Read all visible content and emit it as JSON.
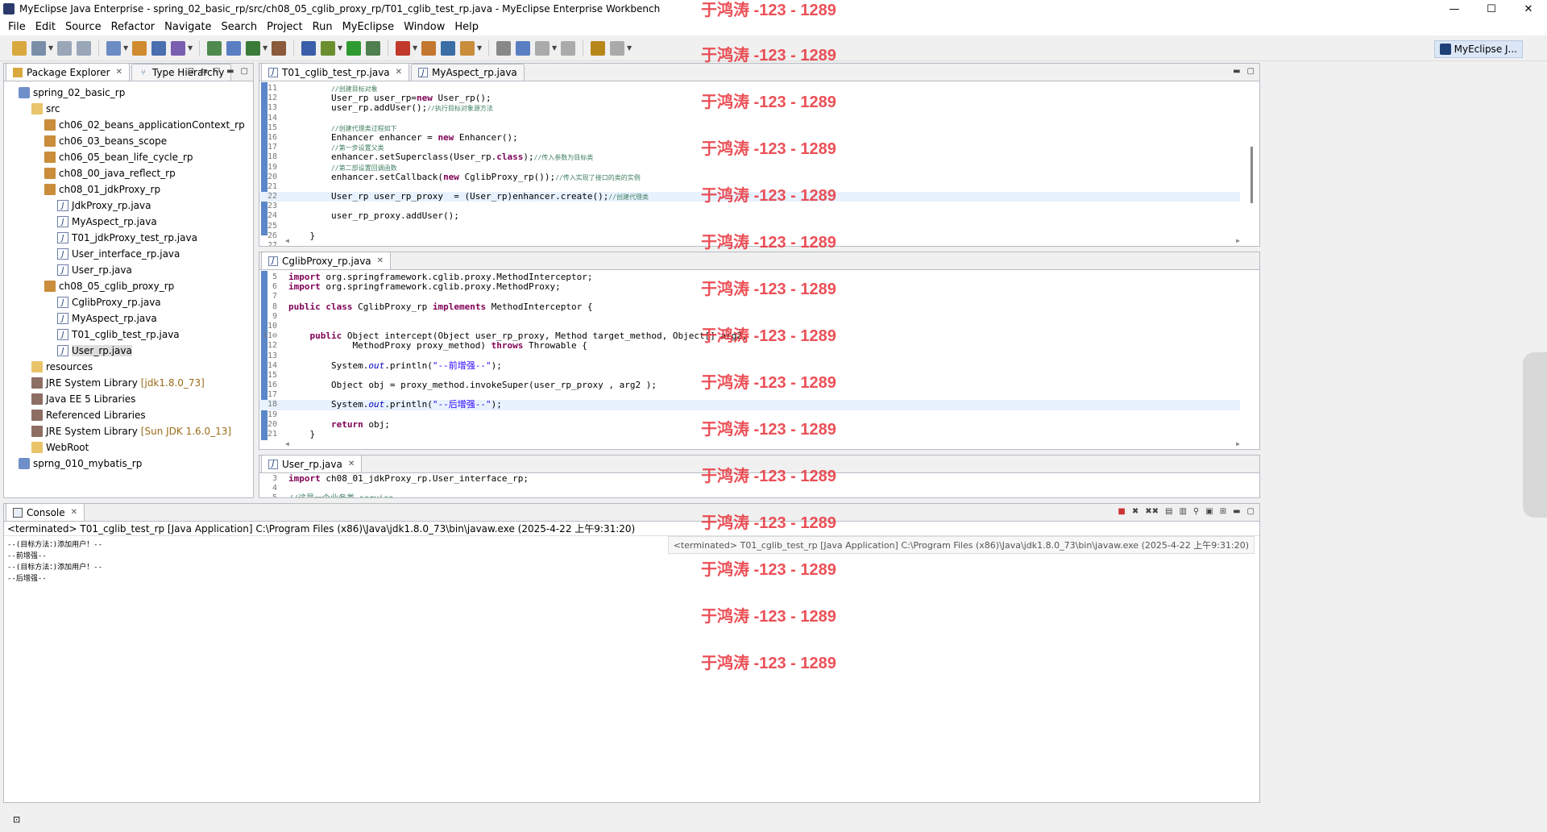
{
  "window": {
    "title": "MyEclipse Java Enterprise - spring_02_basic_rp/src/ch08_05_cglib_proxy_rp/T01_cglib_test_rp.java - MyEclipse Enterprise Workbench",
    "minimize": "—",
    "maximize": "☐",
    "close": "✕"
  },
  "menu": [
    "File",
    "Edit",
    "Source",
    "Refactor",
    "Navigate",
    "Search",
    "Project",
    "Run",
    "MyEclipse",
    "Window",
    "Help"
  ],
  "perspective": {
    "label": "MyEclipse J..."
  },
  "explorer": {
    "tabs": [
      "Package Explorer",
      "Type Hierarchy"
    ],
    "tree": [
      {
        "label": "spring_02_basic_rp",
        "indent": 0,
        "icon": "project-icon"
      },
      {
        "label": "src",
        "indent": 1,
        "icon": "source-folder-icon"
      },
      {
        "label": "ch06_02_beans_applicationContext_rp",
        "indent": 2,
        "icon": "package-icon"
      },
      {
        "label": "ch06_03_beans_scope",
        "indent": 2,
        "icon": "package-icon"
      },
      {
        "label": "ch06_05_bean_life_cycle_rp",
        "indent": 2,
        "icon": "package-icon"
      },
      {
        "label": "ch08_00_java_reflect_rp",
        "indent": 2,
        "icon": "package-icon"
      },
      {
        "label": "ch08_01_jdkProxy_rp",
        "indent": 2,
        "icon": "package-icon"
      },
      {
        "label": "JdkProxy_rp.java",
        "indent": 3,
        "icon": "java-file-icon"
      },
      {
        "label": "MyAspect_rp.java",
        "indent": 3,
        "icon": "java-file-icon"
      },
      {
        "label": "T01_jdkProxy_test_rp.java",
        "indent": 3,
        "icon": "java-file-icon"
      },
      {
        "label": "User_interface_rp.java",
        "indent": 3,
        "icon": "java-file-icon"
      },
      {
        "label": "User_rp.java",
        "indent": 3,
        "icon": "java-file-icon"
      },
      {
        "label": "ch08_05_cglib_proxy_rp",
        "indent": 2,
        "icon": "package-icon"
      },
      {
        "label": "CglibProxy_rp.java",
        "indent": 3,
        "icon": "java-file-icon"
      },
      {
        "label": "MyAspect_rp.java",
        "indent": 3,
        "icon": "java-file-icon"
      },
      {
        "label": "T01_cglib_test_rp.java",
        "indent": 3,
        "icon": "java-file-icon"
      },
      {
        "label": "User_rp.java",
        "indent": 3,
        "icon": "java-file-icon",
        "selected": true
      },
      {
        "label": "resources",
        "indent": 1,
        "icon": "source-folder-icon"
      },
      {
        "label": "JRE System Library",
        "indent": 1,
        "icon": "library-icon",
        "extra": "[jdk1.8.0_73]"
      },
      {
        "label": "Java EE 5 Libraries",
        "indent": 1,
        "icon": "library-icon"
      },
      {
        "label": "Referenced Libraries",
        "indent": 1,
        "icon": "library-icon"
      },
      {
        "label": "JRE System Library",
        "indent": 1,
        "icon": "library-icon",
        "extra": "[Sun JDK 1.6.0_13]"
      },
      {
        "label": "WebRoot",
        "indent": 1,
        "icon": "folder-icon"
      },
      {
        "label": "sprng_010_mybatis_rp",
        "indent": 0,
        "icon": "project-icon"
      }
    ]
  },
  "editor1": {
    "tabs": [
      "T01_cglib_test_rp.java",
      "MyAspect_rp.java"
    ],
    "lines": [
      {
        "n": "11",
        "html": "        <span class=\"cm\">//创建目标对象</span>"
      },
      {
        "n": "12",
        "html": "        User_rp user_rp=<span class=\"kw\">new</span> User_rp();"
      },
      {
        "n": "13",
        "html": "        user_rp.addUser();<span class=\"cm\">//执行目标对象源方法</span>"
      },
      {
        "n": "14",
        "html": ""
      },
      {
        "n": "15",
        "html": "        <span class=\"cm\">//创建代理类过程如下</span>"
      },
      {
        "n": "16",
        "html": "        Enhancer enhancer = <span class=\"kw\">new</span> Enhancer();"
      },
      {
        "n": "17",
        "html": "        <span class=\"cm\">//第一步设置父类</span>"
      },
      {
        "n": "18",
        "html": "        enhancer.setSuperclass(User_rp.<span class=\"kw\">class</span>);<span class=\"cm\">//传入参数为目标类</span>"
      },
      {
        "n": "19",
        "html": "        <span class=\"cm\">//第二部设置回调函数</span>"
      },
      {
        "n": "20",
        "html": "        enhancer.setCallback(<span class=\"kw\">new</span> CglibProxy_rp());<span class=\"cm\">//传入实现了接口的类的实例</span>"
      },
      {
        "n": "21",
        "html": ""
      },
      {
        "n": "22",
        "html": "        User_rp user_rp_proxy  = (User_rp)enhancer.create();<span class=\"cm\">//创建代理类</span>",
        "hl": true
      },
      {
        "n": "23",
        "html": ""
      },
      {
        "n": "24",
        "html": "        user_rp_proxy.addUser();"
      },
      {
        "n": "25",
        "html": ""
      },
      {
        "n": "26",
        "html": "    }"
      },
      {
        "n": "27",
        "html": ""
      }
    ]
  },
  "editor2": {
    "tabs": [
      "CglibProxy_rp.java"
    ],
    "lines": [
      {
        "n": "5",
        "html": "<span class=\"kw\">import</span> org.springframework.cglib.proxy.MethodInterceptor;"
      },
      {
        "n": "6",
        "html": "<span class=\"kw\">import</span> org.springframework.cglib.proxy.MethodProxy;"
      },
      {
        "n": "7",
        "html": ""
      },
      {
        "n": "8",
        "html": "<span class=\"kw\">public</span> <span class=\"kw\">class</span> CglibProxy_rp <span class=\"kw\">implements</span> MethodInterceptor {"
      },
      {
        "n": "9",
        "html": ""
      },
      {
        "n": "10",
        "html": ""
      },
      {
        "n": "11⊖",
        "html": "    <span class=\"kw\">public</span> Object intercept(Object user_rp_proxy, Method target_method, Object[] arg2,"
      },
      {
        "n": "12",
        "html": "            MethodProxy proxy_method) <span class=\"kw\">throws</span> Throwable {"
      },
      {
        "n": "13",
        "html": ""
      },
      {
        "n": "14",
        "html": "        System.<span class=\"fld\">out</span>.println(<span class=\"str\">\"--前增强--\"</span>);"
      },
      {
        "n": "15",
        "html": ""
      },
      {
        "n": "16",
        "html": "        Object obj = proxy_method.invokeSuper(user_rp_proxy , arg2 );"
      },
      {
        "n": "17",
        "html": ""
      },
      {
        "n": "18",
        "html": "        System.<span class=\"fld\">out</span>.println(<span class=\"str\">\"--后增强--\"</span>);",
        "hl": true
      },
      {
        "n": "19",
        "html": ""
      },
      {
        "n": "20",
        "html": "        <span class=\"kw\">return</span> obj;"
      },
      {
        "n": "21",
        "html": "    }"
      }
    ]
  },
  "editor3": {
    "tabs": [
      "User_rp.java"
    ],
    "lines": [
      {
        "n": "3",
        "html": "<span class=\"kw\">import</span> ch08_01_jdkProxy_rp.User_interface_rp;"
      },
      {
        "n": "4",
        "html": ""
      },
      {
        "n": "5",
        "html": "<span class=\"cm\" style=\"font-size:10px\">//这是一个业务类,service</span>"
      }
    ]
  },
  "console": {
    "tab": "Console",
    "info": "<terminated> T01_cglib_test_rp [Java Application] C:\\Program Files (x86)\\Java\\jdk1.8.0_73\\bin\\javaw.exe (2025-4-22 上午9:31:20)",
    "output": [
      "--(目标方法：)添加用户！--",
      "--前增强--",
      "--(目标方法：)添加用户！--",
      "--后增强--"
    ]
  },
  "watermark": "于鸿涛 -123 - 1289",
  "colors": {
    "accent": "#5b87c9",
    "keyword": "#7f0055",
    "comment": "#3f7f5f",
    "string": "#2a00ff",
    "watermark": "#e8323a"
  }
}
